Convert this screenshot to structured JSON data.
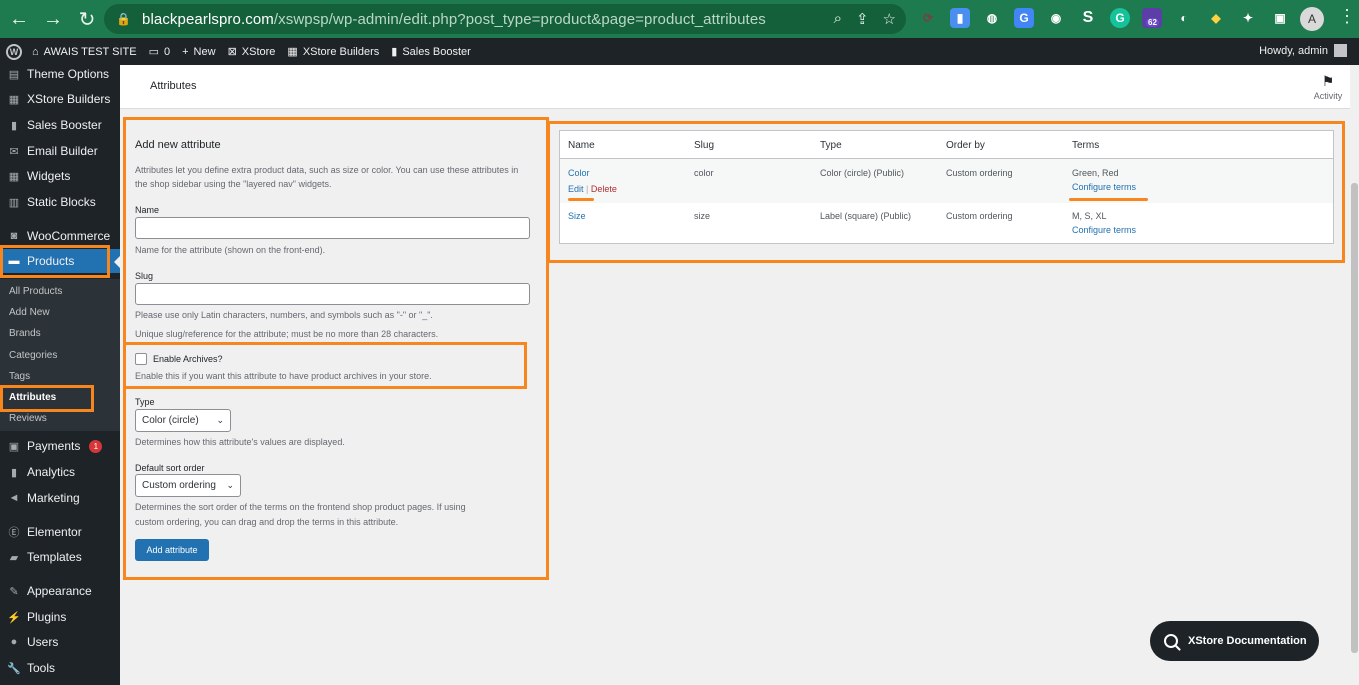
{
  "browser": {
    "url_host": "blackpearlspro.com",
    "url_path": "/xswpsp/wp-admin/edit.php?post_type=product&page=product_attributes",
    "extension_badge": "62",
    "profile_initial": "A"
  },
  "adminbar": {
    "site_name": "AWAIS TEST SITE",
    "comments_count": "0",
    "new_label": "New",
    "xstore_label": "XStore",
    "xstore_builders_label": "XStore Builders",
    "sales_booster_label": "Sales Booster",
    "howdy": "Howdy, admin"
  },
  "sidebar": {
    "items": [
      {
        "label": "Theme Options",
        "icon": "sliders-icon"
      },
      {
        "label": "XStore Builders",
        "icon": "grid-icon"
      },
      {
        "label": "Sales Booster",
        "icon": "bars-icon"
      },
      {
        "label": "Email Builder",
        "icon": "mail-icon"
      },
      {
        "label": "Widgets",
        "icon": "widgets-icon"
      },
      {
        "label": "Static Blocks",
        "icon": "blocks-icon"
      },
      {
        "label": "WooCommerce",
        "icon": "woo-icon"
      },
      {
        "label": "Products",
        "icon": "archive-icon"
      }
    ],
    "sub_items": [
      "All Products",
      "Add New",
      "Brands",
      "Categories",
      "Tags",
      "Attributes",
      "Reviews"
    ],
    "bottom_items": [
      {
        "label": "Payments",
        "badge": "1"
      },
      {
        "label": "Analytics"
      },
      {
        "label": "Marketing"
      },
      {
        "label": "Elementor"
      },
      {
        "label": "Templates"
      },
      {
        "label": "Appearance"
      },
      {
        "label": "Plugins"
      },
      {
        "label": "Users"
      },
      {
        "label": "Tools"
      }
    ]
  },
  "header": {
    "title": "Attributes",
    "activity_label": "Activity"
  },
  "form": {
    "title": "Add new attribute",
    "intro": "Attributes let you define extra product data, such as size or color. You can use these attributes in",
    "intro2": "the shop sidebar using the \"layered nav\" widgets.",
    "name_label": "Name",
    "name_value": "",
    "name_desc": "Name for the attribute (shown on the front-end).",
    "slug_label": "Slug",
    "slug_value": "",
    "slug_desc1": "Please use only Latin characters, numbers, and symbols such as \"-\" or \"_\".",
    "slug_desc2": "Unique slug/reference for the attribute; must be no more than 28 characters.",
    "archives_label": "Enable Archives?",
    "archives_desc": "Enable this if you want this attribute to have product archives in your store.",
    "type_label": "Type",
    "type_value": "Color (circle)",
    "type_desc": "Determines how this attribute's values are displayed.",
    "sort_label": "Default sort order",
    "sort_value": "Custom ordering",
    "sort_desc1": "Determines the sort order of the terms on the frontend shop product pages. If using",
    "sort_desc2": "custom ordering, you can drag and drop the terms in this attribute.",
    "submit_label": "Add attribute"
  },
  "table": {
    "headers": [
      "Name",
      "Slug",
      "Type",
      "Order by",
      "Terms"
    ],
    "rows": [
      {
        "name": "Color",
        "edit": "Edit",
        "delete": "Delete",
        "slug": "color",
        "type": "Color (circle) (Public)",
        "order": "Custom ordering",
        "terms": "Green, Red",
        "configure": "Configure terms"
      },
      {
        "name": "Size",
        "slug": "size",
        "type": "Label (square) (Public)",
        "order": "Custom ordering",
        "terms": "M, S, XL",
        "configure": "Configure terms"
      }
    ]
  },
  "doc_button": "XStore Documentation",
  "colors": {
    "highlight": "#f7861f",
    "wp_blue": "#2271b1",
    "chrome_green": "#1e7a4f"
  }
}
